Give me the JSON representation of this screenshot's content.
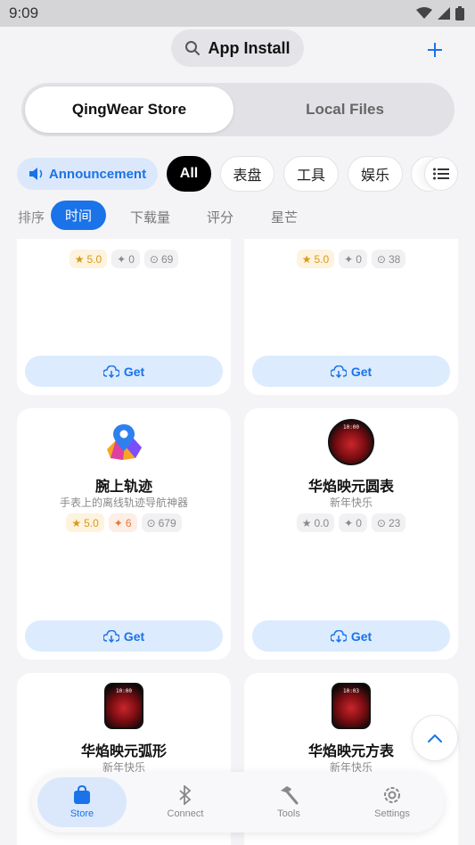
{
  "status": {
    "time": "9:09"
  },
  "header": {
    "title": "App Install"
  },
  "segments": {
    "active": "QingWear Store",
    "inactive": "Local Files"
  },
  "categories": {
    "announcement": "Announcement",
    "chips": [
      "All",
      "表盘",
      "工具",
      "娱乐"
    ]
  },
  "sort": {
    "label": "排序",
    "options": [
      "时间",
      "下载量",
      "评分",
      "星芒"
    ]
  },
  "cards": [
    {
      "name": "",
      "desc": "",
      "rating": "5.0",
      "likes": "0",
      "downloads": "69",
      "get": "Get"
    },
    {
      "name": "",
      "desc": "",
      "rating": "5.0",
      "likes": "0",
      "downloads": "38",
      "get": "Get"
    },
    {
      "name": "腕上轨迹",
      "desc": "手表上的离线轨迹导航神器",
      "rating": "5.0",
      "likes": "6",
      "downloads": "679",
      "get": "Get",
      "icon": "map-pin-icon"
    },
    {
      "name": "华焰映元圆表",
      "desc": "新年快乐",
      "rating": "0.0",
      "likes": "0",
      "downloads": "23",
      "get": "Get",
      "icon": "watchface-round-icon"
    },
    {
      "name": "华焰映元弧形",
      "desc": "新年快乐",
      "icon": "watchface-arc-icon"
    },
    {
      "name": "华焰映元方表",
      "desc": "新年快乐",
      "icon": "watchface-square-icon"
    }
  ],
  "nav": {
    "store": "Store",
    "connect": "Connect",
    "tools": "Tools",
    "settings": "Settings"
  },
  "colors": {
    "accent": "#1a73e8",
    "rating": "#d99a1a",
    "likes": "#e57a3c"
  }
}
